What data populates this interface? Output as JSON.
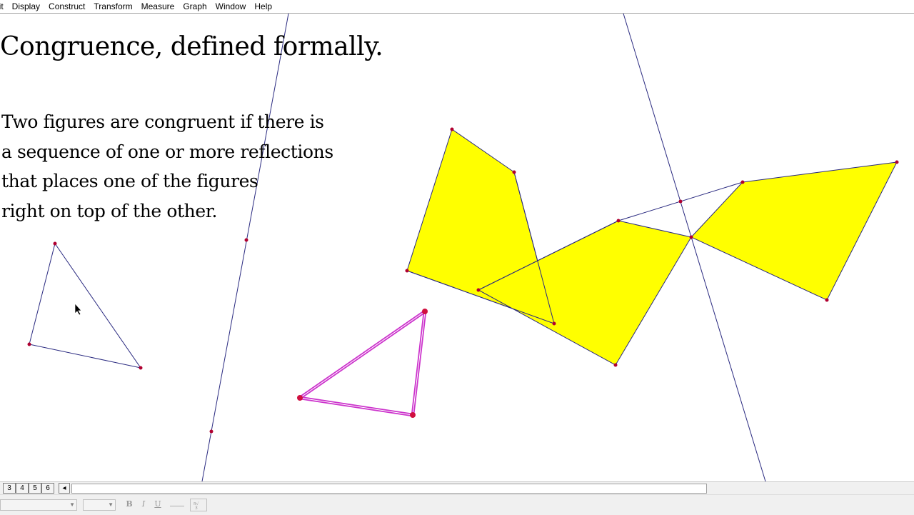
{
  "menu": [
    "lit",
    "Display",
    "Construct",
    "Transform",
    "Measure",
    "Graph",
    "Window",
    "Help"
  ],
  "title": "Congruence, defined formally.",
  "body_lines": [
    "Two figures are congruent if there is",
    "a sequence of one or more reflections",
    "that places one of the figures",
    "right on top of the other."
  ],
  "page_tabs": [
    "3",
    "4",
    "5",
    "6"
  ],
  "page_scroll_arrow": "◂",
  "format_buttons": {
    "bold": "B",
    "italic": "I",
    "underline": "U"
  },
  "colors": {
    "line": "#2a2a80",
    "point": "#b00030",
    "fill": "#ffff00",
    "selected": "#cc33cc"
  },
  "icons": [
    "cursor-arrow-icon",
    "dropdown-arrow-icon",
    "symbol-palette-icon"
  ]
}
